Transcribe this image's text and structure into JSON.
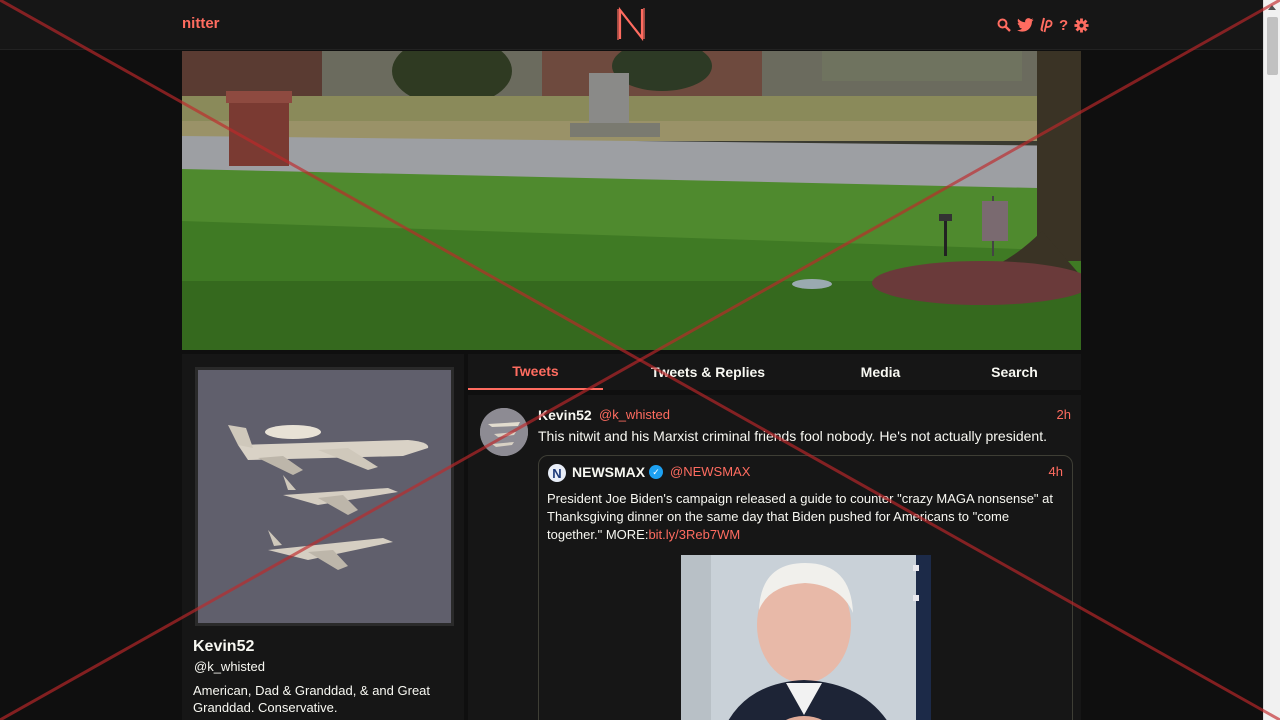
{
  "nav": {
    "brand": "nitter",
    "icons": [
      "search-icon",
      "twitter-bird-icon",
      "liberapay-icon",
      "help-icon",
      "gear-icon"
    ]
  },
  "profile": {
    "fullname": "Kevin52",
    "username": "@k_whisted",
    "bio": "American, Dad & Granddad, & and Great Granddad. Conservative."
  },
  "tabs": [
    {
      "label": "Tweets",
      "active": true
    },
    {
      "label": "Tweets & Replies",
      "active": false
    },
    {
      "label": "Media",
      "active": false
    },
    {
      "label": "Search",
      "active": false
    }
  ],
  "tweet": {
    "fullname": "Kevin52",
    "username": "@k_whisted",
    "date": "2h",
    "text": "This nitwit and his Marxist criminal friends fool nobody. He's not actually president.",
    "quote": {
      "avatar_letter": "N",
      "fullname": "NEWSMAX",
      "username": "@NEWSMAX",
      "date": "4h",
      "text": "President Joe Biden's campaign released a guide to counter \"crazy MAGA nonsense\" at Thanksgiving dinner on the same day that Biden pushed for Americans to \"come together.\"  MORE:",
      "link": "bit.ly/3Reb7WM"
    }
  },
  "colors": {
    "accent": "#ff6c60",
    "background": "#0f0f0f",
    "panel": "#161616",
    "overlay_x": "#c0282a"
  }
}
